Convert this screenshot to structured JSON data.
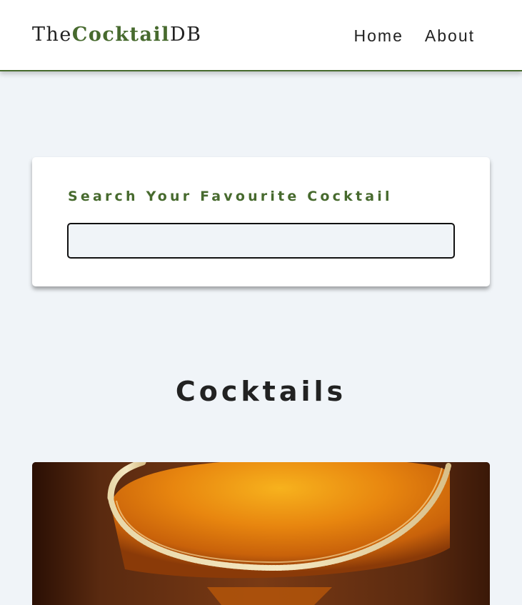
{
  "nav": {
    "logo_prefix": "The",
    "logo_accent": "Cocktail",
    "logo_suffix": "DB",
    "links": [
      "Home",
      "About"
    ]
  },
  "search": {
    "label": "Search Your Favourite Cocktail",
    "value": "",
    "placeholder": ""
  },
  "section": {
    "title": "Cocktails"
  },
  "colors": {
    "accent": "#476a2e",
    "background": "#f0f4f8",
    "card": "#ffffff"
  }
}
